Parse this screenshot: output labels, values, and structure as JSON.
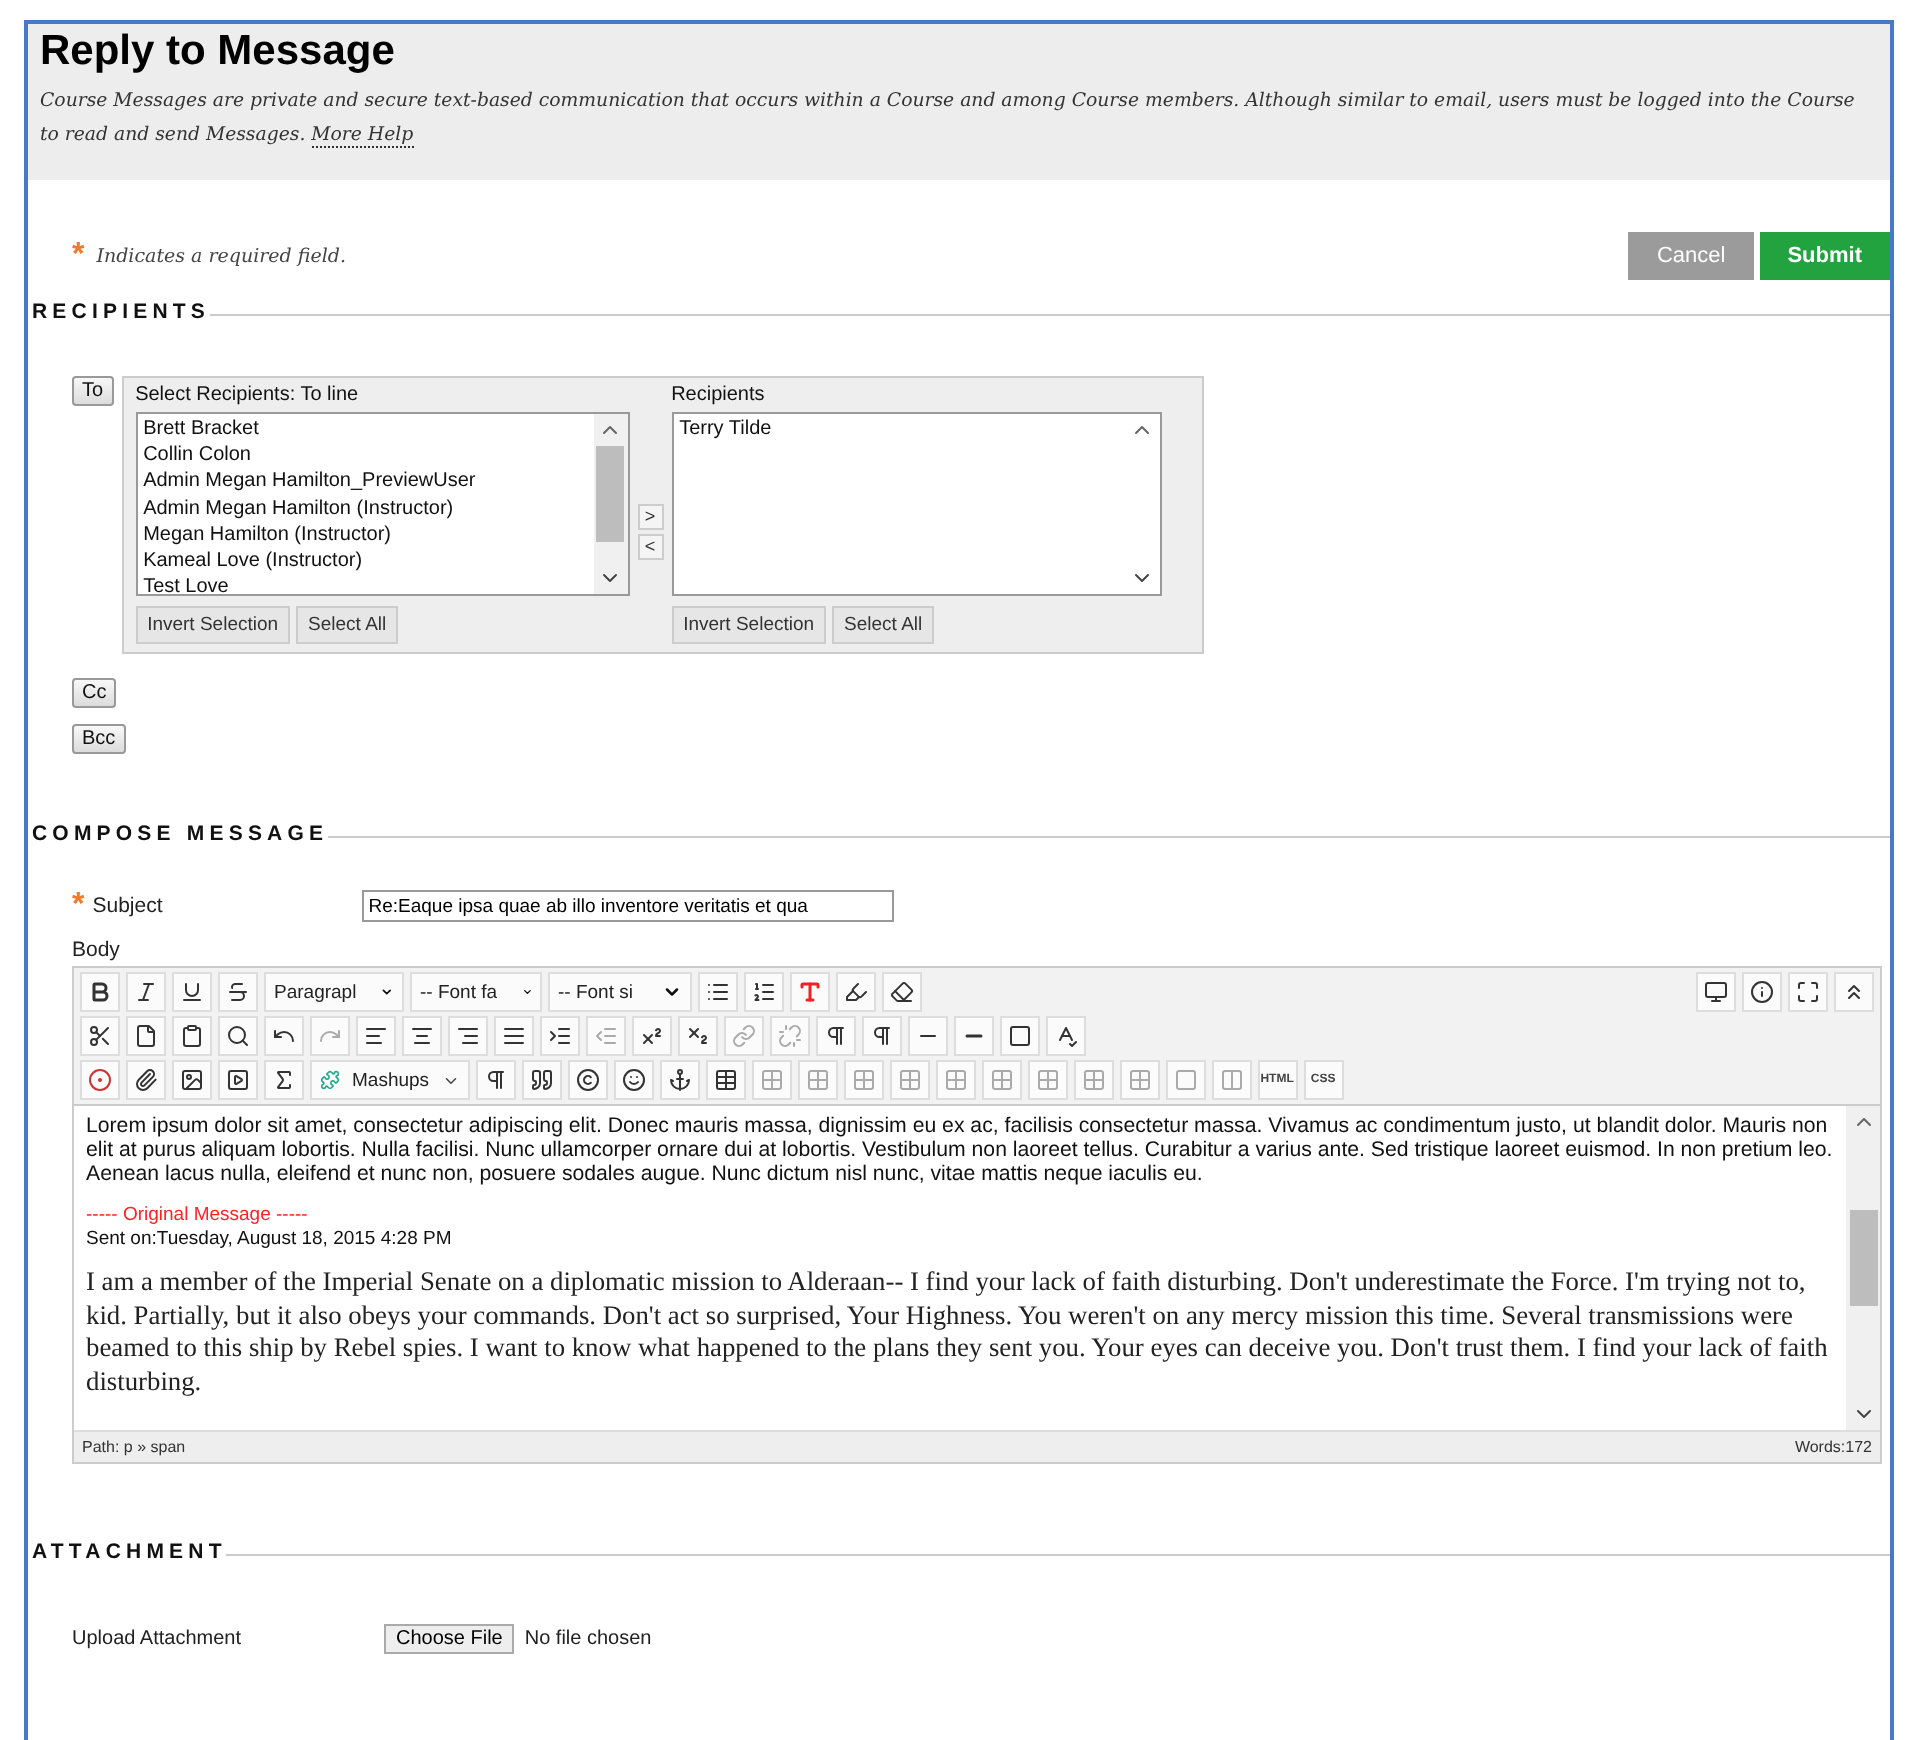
{
  "header": {
    "title": "Reply to Message",
    "description": "Course Messages are private and secure text-based communication that occurs within a Course and among Course members. Although similar to email, users must be logged into the Course to read and send Messages.",
    "help_link": "More Help"
  },
  "required_note": {
    "marker": "*",
    "text": "Indicates a required field."
  },
  "actions": [
    {
      "label": "Cancel",
      "kind": "secondary"
    },
    {
      "label": "Submit",
      "kind": "primary"
    }
  ],
  "recipients": {
    "heading": "RECIPIENTS",
    "to_button": "To",
    "cc_button": "Cc",
    "bcc_button": "Bcc",
    "available": {
      "label": "Select Recipients: To line",
      "items": [
        "Brett Bracket",
        "Collin Colon",
        "Admin Megan Hamilton_PreviewUser",
        "Admin Megan Hamilton (Instructor)",
        "Megan Hamilton (Instructor)",
        "Kameal Love (Instructor)",
        "Test Love"
      ],
      "buttons": [
        "Invert Selection",
        "Select All"
      ]
    },
    "move_buttons": [
      ">",
      "<"
    ],
    "selected": {
      "label": "Recipients",
      "items": [
        "Terry Tilde"
      ],
      "buttons": [
        "Invert Selection",
        "Select All"
      ]
    }
  },
  "compose": {
    "heading": "COMPOSE MESSAGE",
    "subject_marker": "*",
    "subject_label": "Subject",
    "subject_value": "Re:Eaque ipsa quae ab illo inventore veritatis et qua",
    "body_label": "Body",
    "toolbar": {
      "dropdowns": [
        "Paragrapl",
        "-- Font fa",
        "-- Font si"
      ],
      "mashups": "Mashups",
      "html": "HTML",
      "css": "CSS"
    },
    "body": {
      "paragraph": "Lorem ipsum dolor sit amet, consectetur adipiscing elit. Donec mauris massa, dignissim eu ex ac, facilisis consectetur massa. Vivamus ac condimentum justo, ut blandit dolor. Mauris non elit at purus aliquam lobortis. Nulla facilisi. Nunc ullamcorper ornare dui at lobortis. Vestibulum non laoreet tellus. Curabitur a varius ante. Sed tristique laoreet euismod. In non pretium leo. Aenean lacus nulla, eleifend et nunc non, posuere sodales augue. Nunc dictum nisl nunc, vitae mattis neque iaculis eu.",
      "original_marker": "----- Original Message -----",
      "sent_on": "Sent on:Tuesday, August 18, 2015 4:28 PM",
      "quoted": "I am a member of the Imperial Senate on a diplomatic mission to Alderaan-- I find your lack of faith disturbing. Don't underestimate the Force. I'm trying not to, kid. Partially, but it also obeys your commands. Don't act so surprised, Your Highness. You weren't on any mercy mission this time. Several transmissions were beamed to this ship by Rebel spies. I want to know what happened to the plans they sent you. Your eyes can deceive you. Don't trust them. I find your lack of faith disturbing."
    },
    "path": "Path: p » span",
    "words": "Words:172"
  },
  "attachment": {
    "heading": "ATTACHMENT",
    "label": "Upload Attachment",
    "button": "Choose File",
    "status": "No file chosen"
  }
}
